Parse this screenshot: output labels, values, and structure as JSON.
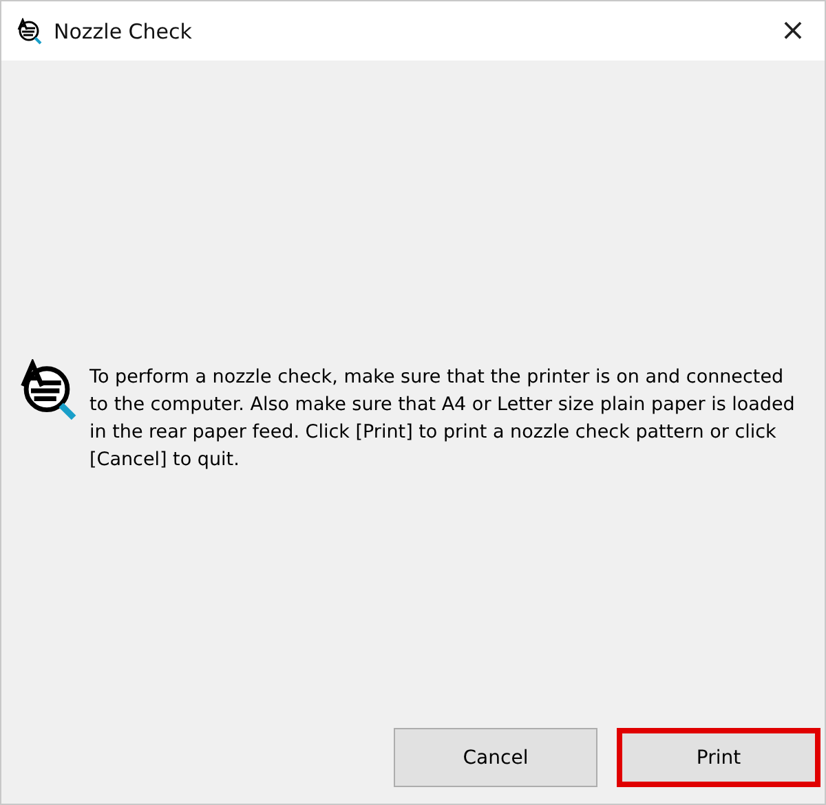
{
  "window": {
    "title": "Nozzle Check",
    "close": "×"
  },
  "message": "To perform a nozzle check, make sure that the printer is on and connected to the computer. Also make sure that A4 or Letter size plain paper is loaded in the rear paper feed. Click [Print] to print a nozzle check pattern or click [Cancel] to quit.",
  "buttons": [
    {
      "label": "Cancel",
      "highlighted": false
    },
    {
      "label": "Print",
      "highlighted": true
    }
  ]
}
